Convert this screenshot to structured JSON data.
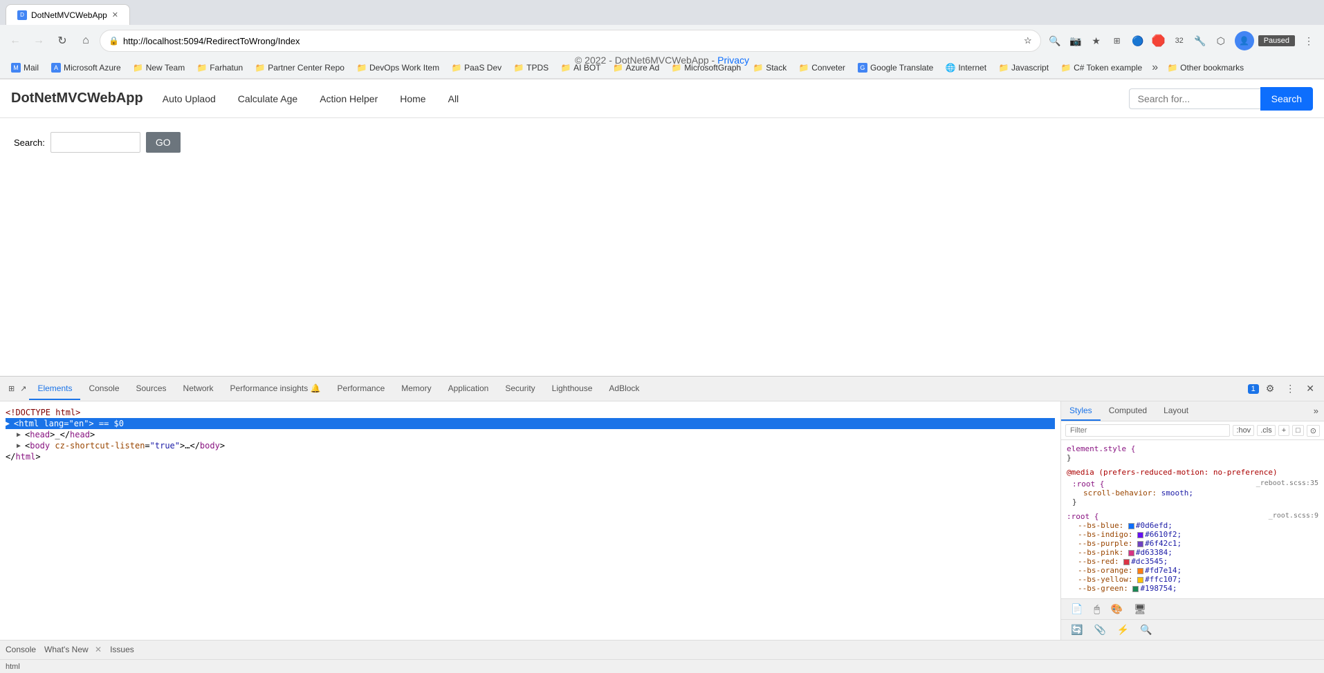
{
  "browser": {
    "tab": {
      "title": "DotNetMVCWebApp",
      "url": "http://localhost:5094/RedirectToWrong/Index"
    },
    "nav_buttons": {
      "back": "←",
      "forward": "→",
      "reload": "↻",
      "home": "⌂"
    },
    "paused_label": "Paused",
    "bookmarks": [
      {
        "name": "Mail",
        "icon": "M",
        "color": "bm-blue"
      },
      {
        "name": "Microsoft Azure",
        "icon": "A",
        "color": "bm-blue"
      },
      {
        "name": "New Team",
        "icon": "📁",
        "color": ""
      },
      {
        "name": "Farhatun",
        "icon": "📁",
        "color": ""
      },
      {
        "name": "Partner Center Repo",
        "icon": "📁",
        "color": ""
      },
      {
        "name": "DevOps Work Item",
        "icon": "📁",
        "color": ""
      },
      {
        "name": "PaaS Dev",
        "icon": "📁",
        "color": ""
      },
      {
        "name": "TPDS",
        "icon": "📁",
        "color": ""
      },
      {
        "name": "AI BOT",
        "icon": "📁",
        "color": ""
      },
      {
        "name": "Azure Ad",
        "icon": "📁",
        "color": ""
      },
      {
        "name": "MicrosoftGraph",
        "icon": "📁",
        "color": ""
      },
      {
        "name": "Stack",
        "icon": "📁",
        "color": ""
      },
      {
        "name": "Conveter",
        "icon": "📁",
        "color": ""
      },
      {
        "name": "Google Translate",
        "icon": "G",
        "color": "bm-blue"
      },
      {
        "name": "Internet",
        "icon": "🌐",
        "color": ""
      },
      {
        "name": "Javascript",
        "icon": "📁",
        "color": ""
      },
      {
        "name": "C# Token example",
        "icon": "📁",
        "color": ""
      }
    ],
    "other_bookmarks": "Other bookmarks"
  },
  "app": {
    "brand": "DotNetMVCWebApp",
    "nav_links": [
      {
        "label": "Auto Uplaod",
        "href": "#"
      },
      {
        "label": "Calculate Age",
        "href": "#"
      },
      {
        "label": "Action Helper",
        "href": "#"
      },
      {
        "label": "Home",
        "href": "#"
      },
      {
        "label": "All",
        "href": "#"
      }
    ],
    "search": {
      "placeholder": "Search for...",
      "button_label": "Search"
    },
    "main": {
      "search_label": "Search:",
      "search_placeholder": "",
      "go_button": "GO"
    },
    "footer": {
      "text": "© 2022 - DotNet6MVCWebApp -",
      "privacy_link": "Privacy"
    }
  },
  "devtools": {
    "tabs": [
      {
        "label": "Elements",
        "active": true
      },
      {
        "label": "Console",
        "active": false
      },
      {
        "label": "Sources",
        "active": false
      },
      {
        "label": "Network",
        "active": false
      },
      {
        "label": "Performance insights 🔔",
        "active": false
      },
      {
        "label": "Performance",
        "active": false
      },
      {
        "label": "Memory",
        "active": false
      },
      {
        "label": "Application",
        "active": false
      },
      {
        "label": "Security",
        "active": false
      },
      {
        "label": "Lighthouse",
        "active": false
      },
      {
        "label": "AdBlock",
        "active": false
      }
    ],
    "dom": {
      "lines": [
        {
          "indent": 0,
          "html": "<!DOCTYPE html>"
        },
        {
          "indent": 0,
          "html": "<html lang=\"en\"> == $0",
          "selected": true
        },
        {
          "indent": 1,
          "html": "<head>_</head>"
        },
        {
          "indent": 1,
          "html": "<body cz-shortcut-listen=\"true\">…</body>"
        },
        {
          "indent": 0,
          "html": "</html>"
        }
      ]
    },
    "styles_tabs": [
      {
        "label": "Styles",
        "active": true
      },
      {
        "label": "Computed",
        "active": false
      },
      {
        "label": "Layout",
        "active": false
      }
    ],
    "styles_filter_placeholder": "Filter",
    "styles_hov": ":hov",
    "styles_cls": ".cls",
    "styles_rules": [
      {
        "selector": "element.style {",
        "properties": [],
        "closing": "}",
        "source": ""
      },
      {
        "selector": "@media (prefers-reduced-motion: no-preference)",
        "properties": [],
        "closing": "",
        "source": ""
      },
      {
        "selector": ":root {",
        "properties": [],
        "source": "_reboot.scss:35",
        "closing_line": "scroll-behavior: smooth;",
        "closing": "}"
      },
      {
        "selector": ":root {",
        "properties": [
          {
            "name": "--bs-blue:",
            "value": "#0d6efd",
            "color": "#0d6efd"
          },
          {
            "name": "--bs-indigo:",
            "value": "#6610f2",
            "color": "#6610f2"
          },
          {
            "name": "--bs-purple:",
            "value": "#6f42c1",
            "color": "#6f42c1"
          },
          {
            "name": "--bs-pink:",
            "value": "#d63384",
            "color": "#d63384"
          },
          {
            "name": "--bs-red:",
            "value": "#dc3545",
            "color": "#dc3545"
          },
          {
            "name": "--bs-orange:",
            "value": "#fd7e14",
            "color": "#fd7e14"
          },
          {
            "name": "--bs-yellow:",
            "value": "#ffc107",
            "color": "#ffc107"
          },
          {
            "name": "--bs-green:",
            "value": "#198754",
            "color": "#198754"
          }
        ],
        "source": "_root.scss:9",
        "closing": ""
      }
    ],
    "console_tabs": [
      {
        "label": "Console",
        "active": false
      },
      {
        "label": "What's New",
        "active": false,
        "closeable": true
      },
      {
        "label": "Issues",
        "active": false
      }
    ],
    "status_text": "html"
  }
}
